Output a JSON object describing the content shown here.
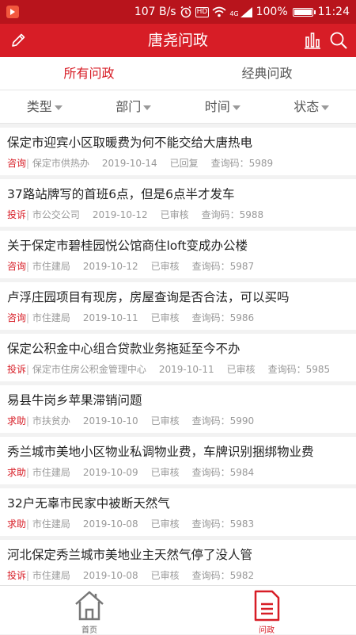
{
  "status": {
    "speed": "107 B/s",
    "battery": "100%",
    "time": "11:24",
    "hd": "HD",
    "net": "4G"
  },
  "header": {
    "title": "唐尧问政"
  },
  "tabs": [
    {
      "label": "所有问政",
      "active": true
    },
    {
      "label": "经典问政",
      "active": false
    }
  ],
  "filters": [
    "类型",
    "部门",
    "时间",
    "状态"
  ],
  "items": [
    {
      "title": "保定市迎宾小区取暖费为何不能交给大唐热电",
      "category": "咨询",
      "dept": "保定市供热办",
      "date": "2019-10-14",
      "status": "已回复",
      "code": "查询码：5989"
    },
    {
      "title": "37路站牌写的首班6点，但是6点半才发车",
      "category": "投诉",
      "dept": "市公交公司",
      "date": "2019-10-12",
      "status": "已审核",
      "code": "查询码：5988"
    },
    {
      "title": "关于保定市碧桂园悦公馆商住loft变成办公楼",
      "category": "咨询",
      "dept": "市住建局",
      "date": "2019-10-12",
      "status": "已审核",
      "code": "查询码：5987"
    },
    {
      "title": "卢浮庄园项目有现房，房屋查询是否合法，可以买吗",
      "category": "咨询",
      "dept": "市住建局",
      "date": "2019-10-11",
      "status": "已审核",
      "code": "查询码：5986"
    },
    {
      "title": "保定公积金中心组合贷款业务拖延至今不办",
      "category": "投诉",
      "dept": "保定市住房公积金管理中心",
      "date": "2019-10-11",
      "status": "已审核",
      "code": "查询码：5985"
    },
    {
      "title": "易县牛岗乡苹果滞销问题",
      "category": "求助",
      "dept": "市扶贫办",
      "date": "2019-10-10",
      "status": "已审核",
      "code": "查询码：5990"
    },
    {
      "title": "秀兰城市美地小区物业私调物业费，车牌识别捆绑物业费",
      "category": "求助",
      "dept": "市住建局",
      "date": "2019-10-09",
      "status": "已审核",
      "code": "查询码：5984"
    },
    {
      "title": "32户无辜市民家中被断天然气",
      "category": "求助",
      "dept": "市住建局",
      "date": "2019-10-08",
      "status": "已审核",
      "code": "查询码：5983"
    },
    {
      "title": "河北保定秀兰城市美地业主天然气停了没人管",
      "category": "投诉",
      "dept": "市住建局",
      "date": "2019-10-08",
      "status": "已审核",
      "code": "查询码：5982"
    }
  ],
  "bottom_nav": [
    {
      "label": "首页",
      "icon": "home-icon",
      "active": false
    },
    {
      "label": "问政",
      "icon": "document-icon",
      "active": true
    }
  ],
  "colors": {
    "primary": "#d71d26",
    "status_bar": "#b8141c",
    "muted": "#999999"
  }
}
